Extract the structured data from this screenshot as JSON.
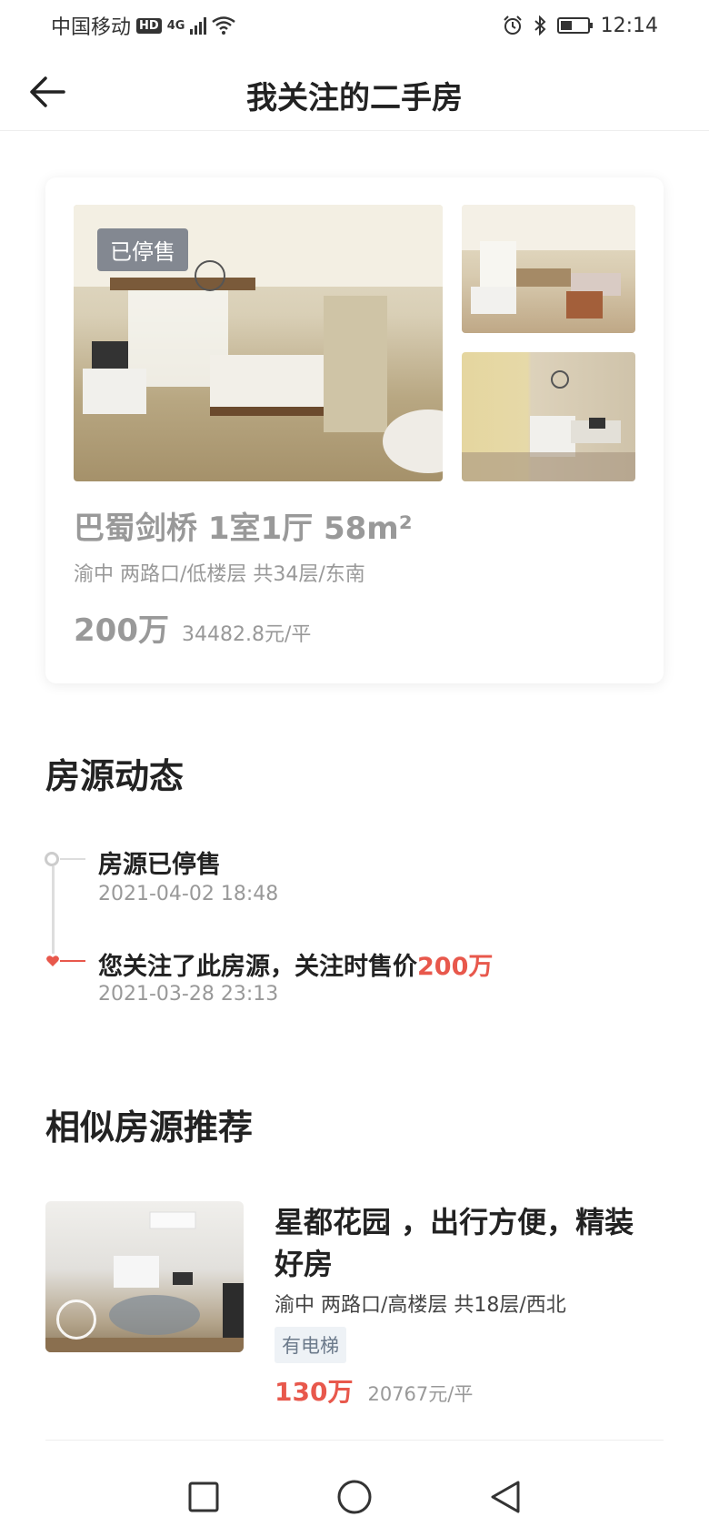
{
  "status_bar": {
    "carrier": "中国移动",
    "hd": "HD",
    "network": "4G",
    "time": "12:14",
    "battery_level": 0.45
  },
  "header": {
    "title": "我关注的二手房",
    "back_icon": "arrow-left-icon"
  },
  "property_card": {
    "badge": "已停售",
    "title": "巴蜀剑桥 1室1厅 58m²",
    "subtitle": "渝中 两路口/低楼层 共34层/东南",
    "total_price": "200万",
    "unit_price": "34482.8元/平"
  },
  "dynamics": {
    "section_title": "房源动态",
    "events": [
      {
        "title": "房源已停售",
        "time": "2021-04-02 18:48"
      },
      {
        "title_prefix": "您关注了此房源，关注时售价",
        "title_highlight": "200万",
        "time": "2021-03-28 23:13"
      }
    ]
  },
  "recommend": {
    "section_title": "相似房源推荐",
    "items": [
      {
        "title": "星都花园 ，出行方便，精装好房",
        "subtitle": "渝中 两路口/高楼层 共18层/西北",
        "tag": "有电梯",
        "total_price": "130万",
        "unit_price": "20767元/平"
      }
    ]
  },
  "nav_bar": {
    "icons": [
      "recent-apps-icon",
      "home-icon",
      "back-triangle-icon"
    ]
  },
  "colors": {
    "accent": "#e8584c",
    "muted": "#999999",
    "tag_bg": "#eef2f6"
  }
}
